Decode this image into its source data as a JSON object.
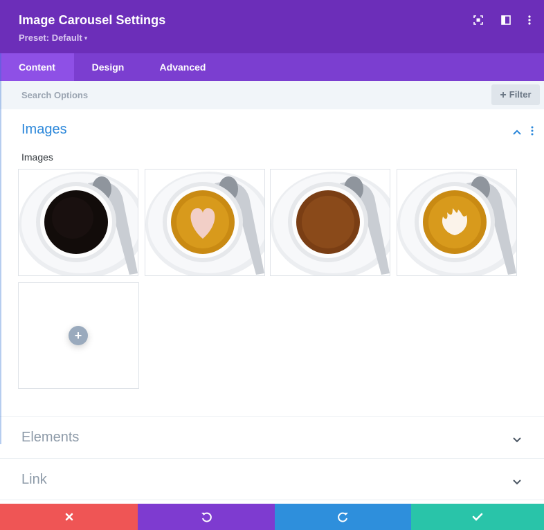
{
  "header": {
    "title": "Image Carousel Settings",
    "preset_label": "Preset: Default",
    "icons": [
      "expand-icon",
      "sidebar-toggle-icon",
      "more-options-icon"
    ]
  },
  "tabs": [
    {
      "label": "Content",
      "active": true
    },
    {
      "label": "Design",
      "active": false
    },
    {
      "label": "Advanced",
      "active": false
    }
  ],
  "search": {
    "placeholder": "Search Options",
    "filter_label": "Filter"
  },
  "sections": {
    "images": {
      "title": "Images",
      "expanded": true,
      "field_label": "Images",
      "gallery": [
        {
          "name": "black coffee"
        },
        {
          "name": "latte heart art"
        },
        {
          "name": "americano"
        },
        {
          "name": "latte tulip art"
        }
      ],
      "add_label": "+"
    },
    "elements": {
      "title": "Elements",
      "expanded": false
    },
    "link": {
      "title": "Link",
      "expanded": false
    }
  },
  "footer": {
    "buttons": [
      {
        "name": "discard",
        "icon": "close-icon",
        "color": "#ef5555"
      },
      {
        "name": "undo",
        "icon": "undo-icon",
        "color": "#7e3bd0"
      },
      {
        "name": "redo",
        "icon": "redo-icon",
        "color": "#2e8fdc"
      },
      {
        "name": "save",
        "icon": "check-icon",
        "color": "#29c4a9"
      }
    ]
  },
  "colors": {
    "header_bg": "#6c2eb9",
    "tabs_bg": "#7b3ed0",
    "active_tab_bg": "#8e50e6",
    "section_title_active": "#2b87da",
    "section_title_collapsed": "#8d9aa8"
  }
}
